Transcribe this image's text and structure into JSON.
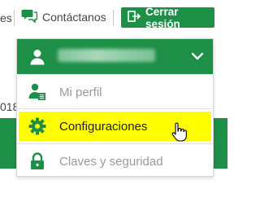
{
  "topbar": {
    "left_fragment": "es",
    "contact_label": "Contáctanos",
    "logout_label": "Cerrar sesión"
  },
  "background": {
    "left_fragment": "018"
  },
  "dropdown": {
    "items": [
      {
        "label": "Mi perfil",
        "icon": "user-profile-icon",
        "state": "disabled"
      },
      {
        "label": "Configuraciones",
        "icon": "gear-icon",
        "state": "highlighted"
      },
      {
        "label": "Claves y seguridad",
        "icon": "lock-icon",
        "state": "disabled"
      }
    ]
  },
  "colors": {
    "brand_green": "#1d8f47",
    "highlight_yellow": "#ffff00",
    "muted_text": "#9a9a9a"
  }
}
